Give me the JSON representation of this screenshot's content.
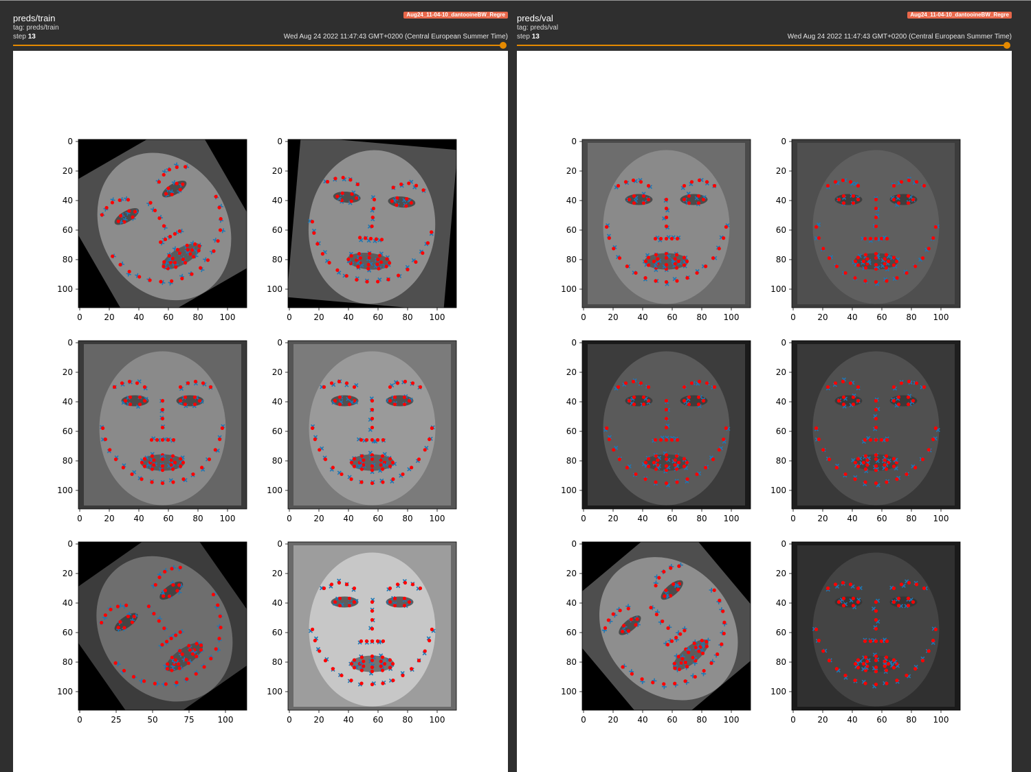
{
  "panels": [
    {
      "title": "preds/train",
      "tag": "tag: preds/train",
      "step_label": "step",
      "step_value": "13",
      "timestamp": "Wed Aug 24 2022 11:47:43 GMT+0200 (Central European Summer Time)",
      "run_name": "Aug24_11-04-10_dantooineBW_Regre",
      "plots": [
        {
          "yticks": [
            "0",
            "20",
            "40",
            "60",
            "80",
            "100"
          ],
          "xticks": [
            "0",
            "20",
            "40",
            "60",
            "80",
            "100"
          ],
          "face": {
            "rot": -30,
            "tone": "#8c8c8c",
            "bg": "#000000"
          },
          "frame": "full"
        },
        {
          "yticks": [
            "0",
            "20",
            "40",
            "60",
            "80",
            "100"
          ],
          "xticks": [
            "0",
            "20",
            "40",
            "60",
            "80",
            "100"
          ],
          "face": {
            "rot": 5,
            "tone": "#8f8f8f",
            "bg": "#000000"
          },
          "frame": "full"
        },
        {
          "yticks": [
            "0",
            "20",
            "40",
            "60",
            "80",
            "100"
          ],
          "xticks": [
            "0",
            "20",
            "40",
            "60",
            "80",
            "100"
          ],
          "face": {
            "rot": 0,
            "tone": "#8a8a8a",
            "bg": "#3a3a3a"
          },
          "frame": "full"
        },
        {
          "yticks": [
            "0",
            "20",
            "40",
            "60",
            "80",
            "100"
          ],
          "xticks": [
            "0",
            "20",
            "40",
            "60",
            "80",
            "100"
          ],
          "face": {
            "rot": 0,
            "tone": "#9a9a9a",
            "bg": "#555555"
          },
          "frame": "full"
        },
        {
          "yticks": [
            "0",
            "20",
            "40",
            "60",
            "80",
            "100"
          ],
          "xticks": [
            "0",
            "25",
            "50",
            "75",
            "100"
          ],
          "face": {
            "rot": -35,
            "tone": "#6e6e6e",
            "bg": "#000000"
          },
          "frame": "wide"
        },
        {
          "yticks": [
            "0",
            "20",
            "40",
            "60",
            "80",
            "100"
          ],
          "xticks": [
            "0",
            "20",
            "40",
            "60",
            "80",
            "100"
          ],
          "face": {
            "rot": 0,
            "tone": "#c7c7c7",
            "bg": "#6a6a6a"
          },
          "frame": "full"
        }
      ]
    },
    {
      "title": "preds/val",
      "tag": "tag: preds/val",
      "step_label": "step",
      "step_value": "13",
      "timestamp": "Wed Aug 24 2022 11:47:43 GMT+0200 (Central European Summer Time)",
      "run_name": "Aug24_11-04-10_dantooineBW_Regre",
      "plots": [
        {
          "yticks": [
            "0",
            "20",
            "40",
            "60",
            "80",
            "100"
          ],
          "xticks": [
            "0",
            "20",
            "40",
            "60",
            "80",
            "100"
          ],
          "face": {
            "rot": 0,
            "tone": "#8a8a8a",
            "bg": "#4a4a4a"
          },
          "frame": "full"
        },
        {
          "yticks": [
            "0",
            "20",
            "40",
            "60",
            "80",
            "100"
          ],
          "xticks": [
            "0",
            "20",
            "40",
            "60",
            "80",
            "100"
          ],
          "face": {
            "rot": 0,
            "tone": "#5f5f5f",
            "bg": "#3c3c3c"
          },
          "frame": "full"
        },
        {
          "yticks": [
            "0",
            "20",
            "40",
            "60",
            "80",
            "100"
          ],
          "xticks": [
            "0",
            "20",
            "40",
            "60",
            "80",
            "100"
          ],
          "face": {
            "rot": 0,
            "tone": "#5a5a5a",
            "bg": "#1a1a1a"
          },
          "frame": "full"
        },
        {
          "yticks": [
            "0",
            "20",
            "40",
            "60",
            "80",
            "100"
          ],
          "xticks": [
            "0",
            "20",
            "40",
            "60",
            "80",
            "100"
          ],
          "face": {
            "rot": 0,
            "tone": "#505050",
            "bg": "#1e1e1e"
          },
          "frame": "full"
        },
        {
          "yticks": [
            "0",
            "20",
            "40",
            "60",
            "80",
            "100"
          ],
          "xticks": [
            "0",
            "20",
            "40",
            "60",
            "80",
            "100"
          ],
          "face": {
            "rot": -40,
            "tone": "#8e8e8e",
            "bg": "#000000"
          },
          "frame": "full"
        },
        {
          "yticks": [
            "0",
            "20",
            "40",
            "60",
            "80",
            "100"
          ],
          "xticks": [
            "0",
            "20",
            "40",
            "60",
            "80",
            "100"
          ],
          "face": {
            "rot": 0,
            "tone": "#444444",
            "bg": "#1a1a1a"
          },
          "frame": "full"
        }
      ]
    }
  ],
  "colors": {
    "accent": "#e58a00",
    "run_badge": "#e8674a",
    "prediction_marker": "#1f77b4",
    "target_marker": "#ff0000"
  }
}
